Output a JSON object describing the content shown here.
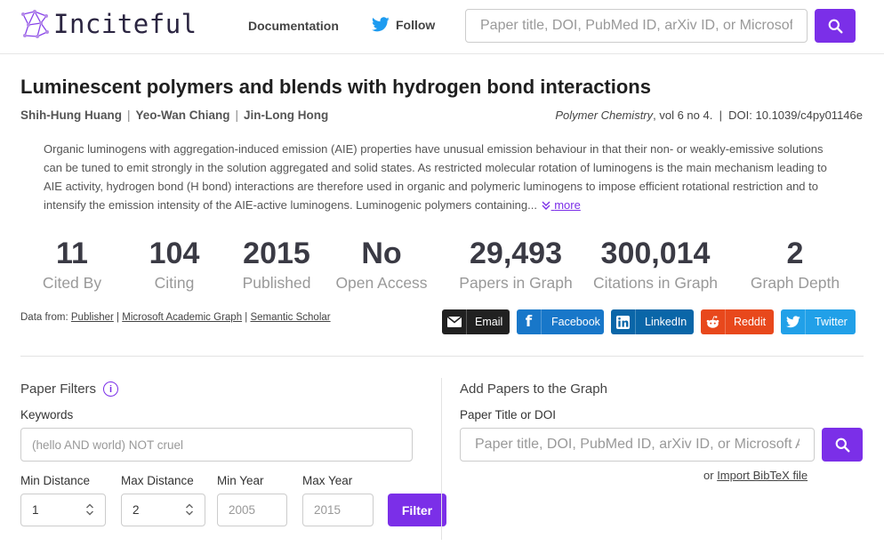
{
  "header": {
    "logo_text": "Inciteful",
    "nav_documentation": "Documentation",
    "nav_follow": "Follow",
    "search_placeholder": "Paper title, DOI, PubMed ID, arXiv ID, or Microsoft"
  },
  "paper": {
    "title": "Luminescent polymers and blends with hydrogen bond interactions",
    "authors": [
      "Shih-Hung Huang",
      "Yeo-Wan Chiang",
      "Jin-Long Hong"
    ],
    "journal_name": "Polymer Chemistry",
    "journal_rest": ", vol 6 no 4.  |  DOI: 10.1039/c4py01146e",
    "abstract": "Organic luminogens with aggregation-induced emission (AIE) properties have unusual emission behaviour in that their non- or weakly-emissive solutions can be tuned to emit strongly in the solution aggregated and solid states. As restricted molecular rotation of luminogens is the main mechanism leading to AIE activity, hydrogen bond (H bond) interactions are therefore used in organic and polymeric luminogens to impose efficient rotational restriction and to intensify the emission intensity of the AIE-active luminogens. Luminogenic polymers containing...",
    "more_label": "more"
  },
  "stats": [
    {
      "value": "11",
      "label": "Cited By"
    },
    {
      "value": "104",
      "label": "Citing"
    },
    {
      "value": "2015",
      "label": "Published"
    },
    {
      "value": "No",
      "label": "Open Access"
    },
    {
      "value": "29,493",
      "label": "Papers in Graph"
    },
    {
      "value": "300,014",
      "label": "Citations in Graph"
    },
    {
      "value": "2",
      "label": "Graph Depth"
    }
  ],
  "datafrom": {
    "prefix": "Data from:",
    "sources": [
      "Publisher",
      "Microsoft Academic Graph",
      "Semantic Scholar"
    ]
  },
  "share": {
    "email": "Email",
    "facebook": "Facebook",
    "linkedin": "LinkedIn",
    "reddit": "Reddit",
    "twitter": "Twitter"
  },
  "colors": {
    "accent": "#7b2fe8",
    "email": "#212121",
    "facebook": "#1877c9",
    "linkedin": "#0a66a8",
    "reddit": "#e8481c",
    "twitter": "#21a0e8"
  },
  "filters": {
    "title": "Paper Filters",
    "keywords_label": "Keywords",
    "keywords_placeholder": "(hello AND world) NOT cruel",
    "min_distance_label": "Min Distance",
    "min_distance_value": "1",
    "max_distance_label": "Max Distance",
    "max_distance_value": "2",
    "min_year_label": "Min Year",
    "min_year_placeholder": "2005",
    "max_year_label": "Max Year",
    "max_year_placeholder": "2015",
    "filter_button": "Filter"
  },
  "add_papers": {
    "title": "Add Papers to the Graph",
    "field_label": "Paper Title or DOI",
    "placeholder": "Paper title, DOI, PubMed ID, arXiv ID, or Microsoft A",
    "import_prefix": "or",
    "import_link": "Import BibTeX file"
  }
}
